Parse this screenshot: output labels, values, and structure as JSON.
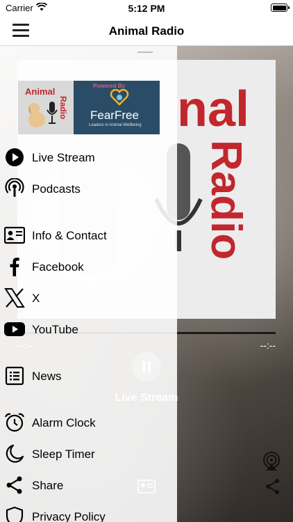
{
  "status_bar": {
    "carrier": "Carrier",
    "time": "5:12 PM"
  },
  "nav": {
    "title": "Animal Radio"
  },
  "logo": {
    "animal": "Animal",
    "radio": "Radio",
    "powered_by": "Powered By",
    "brand": "FearFree",
    "tagline": "Leaders in Animal Wellbeing"
  },
  "menu": {
    "items": [
      {
        "label": "Live Stream",
        "icon": "play-circle-icon"
      },
      {
        "label": "Podcasts",
        "icon": "podcast-icon"
      },
      {
        "label": "Info & Contact",
        "icon": "contact-card-icon"
      },
      {
        "label": "Facebook",
        "icon": "facebook-icon"
      },
      {
        "label": "X",
        "icon": "x-icon"
      },
      {
        "label": "YouTube",
        "icon": "youtube-icon"
      },
      {
        "label": "News",
        "icon": "news-icon"
      },
      {
        "label": "Alarm Clock",
        "icon": "alarm-clock-icon"
      },
      {
        "label": "Sleep Timer",
        "icon": "moon-icon"
      },
      {
        "label": "Share",
        "icon": "share-icon"
      },
      {
        "label": "Privacy Policy",
        "icon": "shield-icon"
      }
    ]
  },
  "player": {
    "artwork_text": "Animal Radio",
    "elapsed": "--:--",
    "remaining": "--:--",
    "title": "Live Stream"
  },
  "colors": {
    "accent_red": "#c1272d",
    "fearfree_navy": "#2b4c66"
  }
}
